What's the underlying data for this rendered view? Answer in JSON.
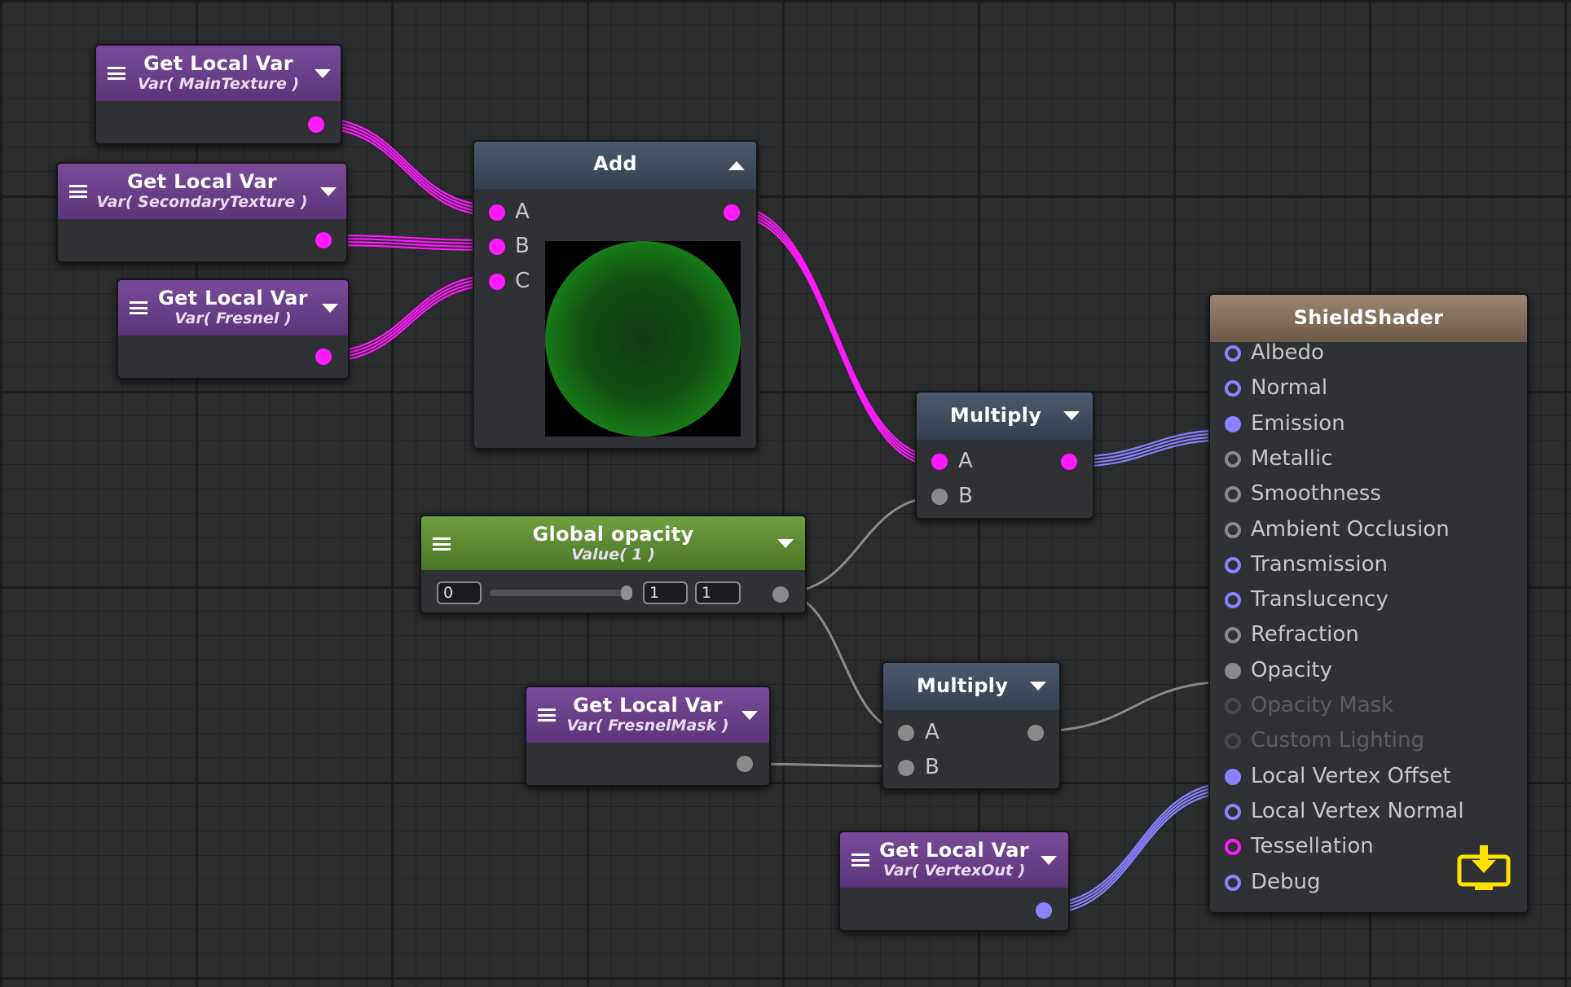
{
  "colors": {
    "canvas": "#2b2c2d",
    "wire_magenta": "#ff1aff",
    "wire_blue": "#8a82ff",
    "wire_gray": "#8a8a8a",
    "header_purple": "#6b3f8a",
    "header_blue": "#3e4b5b",
    "header_green": "#5c8c33",
    "header_tan": "#8a7660",
    "save_icon": "#ffe100"
  },
  "nodes": {
    "var_main": {
      "title": "Get Local Var",
      "subtitle": "Var( MainTexture )"
    },
    "var_secondary": {
      "title": "Get Local Var",
      "subtitle": "Var( SecondaryTexture )"
    },
    "var_fresnel": {
      "title": "Get Local Var",
      "subtitle": "Var( Fresnel )"
    },
    "add": {
      "title": "Add",
      "inputs": [
        "A",
        "B",
        "C"
      ]
    },
    "multiply1": {
      "title": "Multiply",
      "inputs": [
        "A",
        "B"
      ]
    },
    "global_opacity": {
      "title": "Global opacity",
      "subtitle": "Value( 1 )",
      "min": "0",
      "value": "1",
      "max": "1",
      "slider_fraction": 1.0
    },
    "var_fresnelmask": {
      "title": "Get Local Var",
      "subtitle": "Var( FresnelMask )"
    },
    "multiply2": {
      "title": "Multiply",
      "inputs": [
        "A",
        "B"
      ]
    },
    "var_vertexout": {
      "title": "Get Local Var",
      "subtitle": "Var( VertexOut )"
    },
    "shield": {
      "title": "ShieldShader",
      "inputs": [
        {
          "label": "Albedo",
          "icon": "ring-blue"
        },
        {
          "label": "Normal",
          "icon": "ring-blue"
        },
        {
          "label": "Emission",
          "icon": "filled-blue"
        },
        {
          "label": "Metallic",
          "icon": "ring-gray"
        },
        {
          "label": "Smoothness",
          "icon": "ring-gray"
        },
        {
          "label": "Ambient Occlusion",
          "icon": "ring-gray"
        },
        {
          "label": "Transmission",
          "icon": "ring-blue"
        },
        {
          "label": "Translucency",
          "icon": "ring-blue"
        },
        {
          "label": "Refraction",
          "icon": "ring-gray"
        },
        {
          "label": "Opacity",
          "icon": "filled-gray"
        },
        {
          "label": "Opacity Mask",
          "icon": "ring-dim"
        },
        {
          "label": "Custom Lighting",
          "icon": "ring-dim"
        },
        {
          "label": "Local Vertex Offset",
          "icon": "filled-blue"
        },
        {
          "label": "Local Vertex Normal",
          "icon": "ring-blue"
        },
        {
          "label": "Tessellation",
          "icon": "ring-magenta"
        },
        {
          "label": "Debug",
          "icon": "ring-blue"
        }
      ],
      "save_icon": "save-to-disk-icon"
    }
  }
}
